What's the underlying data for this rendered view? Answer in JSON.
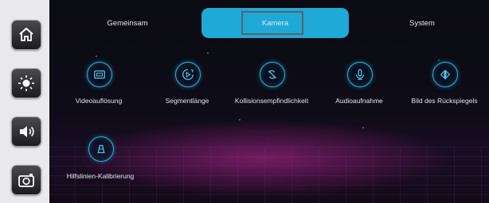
{
  "tabs": [
    {
      "label": "Gemeinsam",
      "active": false
    },
    {
      "label": "Kamera",
      "active": true
    },
    {
      "label": "System",
      "active": false
    }
  ],
  "sidebar": {
    "items": [
      {
        "icon": "home-icon"
      },
      {
        "icon": "brightness-icon"
      },
      {
        "icon": "volume-icon"
      },
      {
        "icon": "camera-icon"
      }
    ]
  },
  "features": [
    {
      "label": "Videoauflösung",
      "icon": "video-resolution-icon"
    },
    {
      "label": "Segmentlänge",
      "icon": "segment-length-icon"
    },
    {
      "label": "Kollisionsempfindlichkeit",
      "icon": "collision-sensitivity-icon"
    },
    {
      "label": "Audioaufnahme",
      "icon": "microphone-icon"
    },
    {
      "label": "Bild des Rückspiegels",
      "icon": "mirror-image-icon"
    },
    {
      "label": "Hilfslinien-Kalibrierung",
      "icon": "guide-lines-icon"
    }
  ],
  "colors": {
    "accent": "#1fa9d6",
    "sidebar_bg": "#e9e9ec",
    "background": "#0b0b12"
  }
}
